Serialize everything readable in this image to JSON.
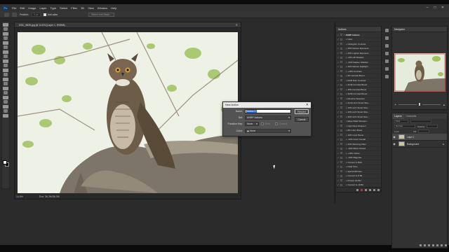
{
  "menubar": {
    "items": [
      "File",
      "Edit",
      "Image",
      "Layer",
      "Type",
      "Select",
      "Filter",
      "3D",
      "View",
      "Window",
      "Help"
    ],
    "logo": "Ps"
  },
  "options_bar": {
    "feather_label": "Feather:",
    "feather_value": "0 px",
    "anti_alias_label": "Anti-alias",
    "select_mask_label": "Select and Mask..."
  },
  "document": {
    "tab_title": "DSC_9625.jpg @ 14.6% (Layer 1, RGB/8)",
    "zoom": "14.6%",
    "doc_info": "Doc: 36.2M/36.2M"
  },
  "actions_panel": {
    "title": "Actions",
    "items": [
      {
        "label": "ANRP Actions",
        "set": true
      },
      {
        "label": "Glow",
        "set": false
      },
      {
        "label": "Histogram Contrast",
        "set": false
      },
      {
        "label": "20% Darken Exposure",
        "set": false
      },
      {
        "label": "20% Lighten Exposure",
        "set": false
      },
      {
        "label": "+5% HR Shadow",
        "set": false
      },
      {
        "label": "-20% Darken Shadow",
        "set": false
      },
      {
        "label": "20% Darken Highlight",
        "set": false
      },
      {
        "label": "+10% Contrast",
        "set": false
      },
      {
        "label": "50 Contrast Boost",
        "set": false
      },
      {
        "label": "RGB Burn Contrast",
        "set": false
      },
      {
        "label": "2(18) Contrast Boost",
        "set": false
      },
      {
        "label": "15% Contrast Boost",
        "set": false
      },
      {
        "label": "2(28) Contrast Boost",
        "set": false
      },
      {
        "label": "Reverse Selection",
        "set": false
      },
      {
        "label": "2(10) Hi-Fi Smart Sha...",
        "set": false
      },
      {
        "label": "10% Hi-Fi Smart Sha...",
        "set": false
      },
      {
        "label": "20% Hi-Fi Smart Sha...",
        "set": false
      },
      {
        "label": "30% Hi-Fi Smart Sha...",
        "set": false
      },
      {
        "label": "Edge Mask Sharpen...",
        "set": false
      },
      {
        "label": "High Pass Sharpen",
        "set": false
      },
      {
        "label": "8% Color Boost",
        "set": false
      },
      {
        "label": "10% Color Boost",
        "set": false
      },
      {
        "label": "-10% Color Overall",
        "set": false
      },
      {
        "label": "20% Warming Filter",
        "set": false
      },
      {
        "label": "-10% Warm Output",
        "set": false
      },
      {
        "label": "+10% Yellow",
        "set": false
      },
      {
        "label": "-10% Magenta",
        "set": false
      },
      {
        "label": "Convert to B/W",
        "set": false
      },
      {
        "label": "Fade Tone",
        "set": false
      },
      {
        "label": "Split RGB Files",
        "set": false
      },
      {
        "label": "Convert to 8 Bit",
        "set": false
      },
      {
        "label": "Protect HL/SH",
        "set": false
      },
      {
        "label": "Convert to 16 Bit",
        "set": false
      }
    ]
  },
  "navigator": {
    "title": "Navigator"
  },
  "layers_panel": {
    "tabs": [
      "Layers",
      "Channels"
    ],
    "kind_label": "Kind",
    "blend_label": "Normal",
    "opacity_label": "Opacity:",
    "lock_label": "Lock:",
    "fill_label": "Fill:",
    "layers": [
      {
        "name": "Layer 1",
        "selected": true
      },
      {
        "name": "Background",
        "selected": false
      }
    ]
  },
  "new_action_dialog": {
    "title": "New Action",
    "name_label": "Name:",
    "name_value": "Action 1",
    "set_label": "Set:",
    "set_value": "ANRP Actions",
    "function_key_label": "Function Key:",
    "function_key_value": "None",
    "shift_label": "Shift",
    "control_label": "Control",
    "color_label": "Color:",
    "color_value": "None",
    "record_button": "Record",
    "cancel_button": "Cancel"
  }
}
